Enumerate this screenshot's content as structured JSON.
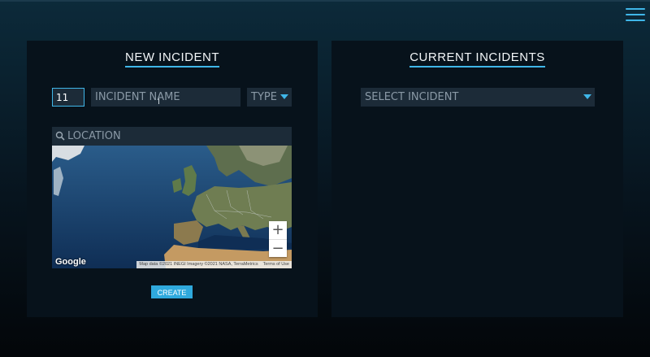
{
  "menu": {
    "icon": "hamburger-menu-icon"
  },
  "new_incident": {
    "title": "NEW INCIDENT",
    "number_value": "11",
    "name_placeholder": "INCIDENT NAME",
    "type_label": "TYPE",
    "location_placeholder": "LOCATION",
    "map": {
      "zoom_in": "+",
      "zoom_out": "−",
      "logo": "Google",
      "attribution": "Map data ©2021 INEGI Imagery ©2021 NASA, TerraMetrics",
      "terms": "Terms of Use"
    },
    "create_label": "CREATE"
  },
  "current_incidents": {
    "title": "CURRENT INCIDENTS",
    "select_placeholder": "SELECT INCIDENT"
  },
  "colors": {
    "accent": "#3fb6e8",
    "panel": "#07121b",
    "field": "#1c2b38"
  }
}
